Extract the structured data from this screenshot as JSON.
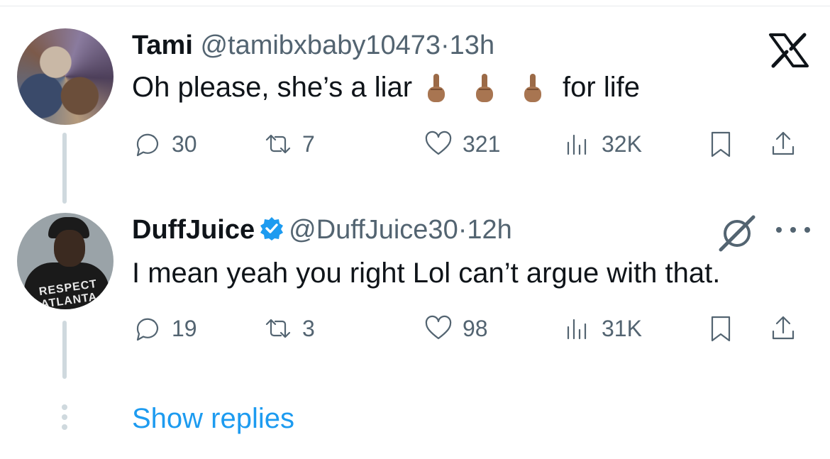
{
  "tweets": [
    {
      "name": "Tami",
      "handle": "@tamibxbaby10473",
      "separator": "·",
      "time": "13h",
      "text_before": "Oh please, she’s a liar",
      "text_after": "for life",
      "stats": {
        "replies": "30",
        "retweets": "7",
        "likes": "321",
        "views": "32K"
      }
    },
    {
      "name": "DuffJuice",
      "handle": "@DuffJuice30",
      "separator": "·",
      "time": "12h",
      "text": "I mean yeah you right Lol can’t argue with that.",
      "stats": {
        "replies": "19",
        "retweets": "3",
        "likes": "98",
        "views": "31K"
      }
    }
  ],
  "avatar_text": "RESPECT ATLANTA",
  "show_replies": "Show replies",
  "icons": [
    "x-logo-icon",
    "reply-icon",
    "retweet-icon",
    "heart-icon",
    "views-icon",
    "bookmark-icon",
    "share-icon",
    "verified-badge-icon",
    "grok-icon",
    "more-icon",
    "middle-finger-emoji"
  ],
  "colors": {
    "text": "#0f1419",
    "secondary": "#536471",
    "link": "#1d9bf0",
    "thread_line": "#cfd9de"
  }
}
